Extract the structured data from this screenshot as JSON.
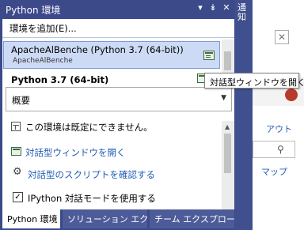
{
  "panel": {
    "title": "Python 環境",
    "controls": {
      "dropdown": "▾",
      "pin": "ᚬ",
      "close": "✕"
    }
  },
  "toolbar": {
    "add_env": "環境を追加(E)..."
  },
  "environments": [
    {
      "name": "ApacheAlBenche (Python 3.7 (64-bit))",
      "sub": "ApacheAlBenche",
      "selected": true
    }
  ],
  "details": {
    "title": "Python 3.7 (64-bit)",
    "view_select": {
      "value": "概要"
    },
    "tooltip": "対話型ウィンドウを開く",
    "items": [
      {
        "label": "この環境は既定にできません。",
        "icon": "info-box-icon",
        "link": false
      },
      {
        "label": "対話型ウィンドウを開く",
        "icon": "interactive-window-icon",
        "link": true
      },
      {
        "label": "対話型のスクリプトを確認する",
        "icon": "gear-icon",
        "link": true
      },
      {
        "label": "IPython 対話モードを使用する",
        "icon": "checkbox",
        "link": false,
        "checked": true
      }
    ]
  },
  "tabs": [
    {
      "label": "Python 環境",
      "active": true
    },
    {
      "label": "ソリューション エク...",
      "active": false
    },
    {
      "label": "チーム エクスプロー...",
      "active": false
    }
  ],
  "background_app": {
    "side_label": "通知",
    "links": [
      "アウト",
      "マップ"
    ]
  },
  "colors": {
    "chrome": "#3c4a8a",
    "selection": "#cddaf5",
    "link": "#1f5cb5"
  }
}
